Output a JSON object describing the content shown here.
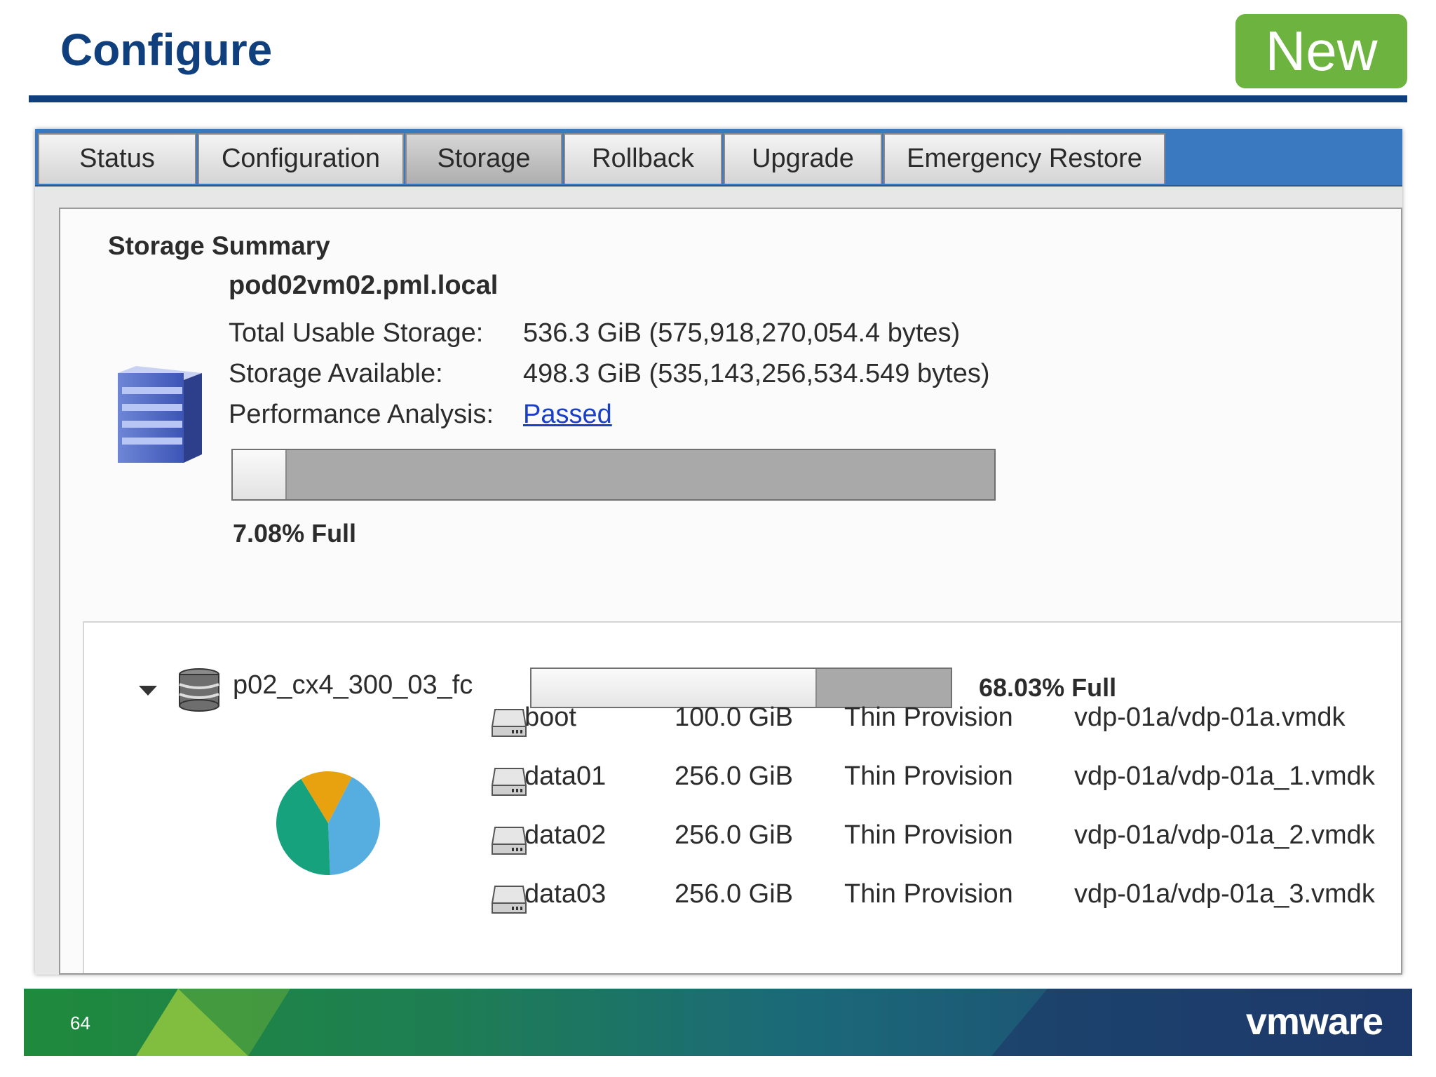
{
  "slide": {
    "title": "Configure",
    "badge": "New",
    "page_number": "64",
    "logo": "vmware"
  },
  "tabs": [
    {
      "label": "Status",
      "active": false
    },
    {
      "label": "Configuration",
      "active": false
    },
    {
      "label": "Storage",
      "active": true
    },
    {
      "label": "Rollback",
      "active": false
    },
    {
      "label": "Upgrade",
      "active": false
    },
    {
      "label": "Emergency Restore",
      "active": false
    }
  ],
  "summary": {
    "heading": "Storage Summary",
    "host": "pod02vm02.pml.local",
    "total_label": "Total Usable Storage:",
    "total_value": "536.3 GiB (575,918,270,054.4 bytes)",
    "available_label": "Storage Available:",
    "available_value": "498.3 GiB (535,143,256,534.549 bytes)",
    "perf_label": "Performance Analysis:",
    "perf_value": "Passed",
    "usage_percent": 7.08,
    "usage_text": "7.08% Full",
    "icon": "storage-stack-icon"
  },
  "datastore": {
    "name": "p02_cx4_300_03_fc",
    "usage_percent": 68.03,
    "usage_text": "68.03% Full",
    "icon": "database-icon",
    "pie_colors": [
      "#e8a20f",
      "#56aee0",
      "#15a27c"
    ],
    "pie_values": [
      100,
      256,
      256
    ],
    "disks": [
      {
        "name": "boot",
        "size": "100.0 GiB",
        "provision": "Thin Provision",
        "path": "vdp-01a/vdp-01a.vmdk"
      },
      {
        "name": "data01",
        "size": "256.0 GiB",
        "provision": "Thin Provision",
        "path": "vdp-01a/vdp-01a_1.vmdk"
      },
      {
        "name": "data02",
        "size": "256.0 GiB",
        "provision": "Thin Provision",
        "path": "vdp-01a/vdp-01a_2.vmdk"
      },
      {
        "name": "data03",
        "size": "256.0 GiB",
        "provision": "Thin Provision",
        "path": "vdp-01a/vdp-01a_3.vmdk"
      }
    ]
  }
}
